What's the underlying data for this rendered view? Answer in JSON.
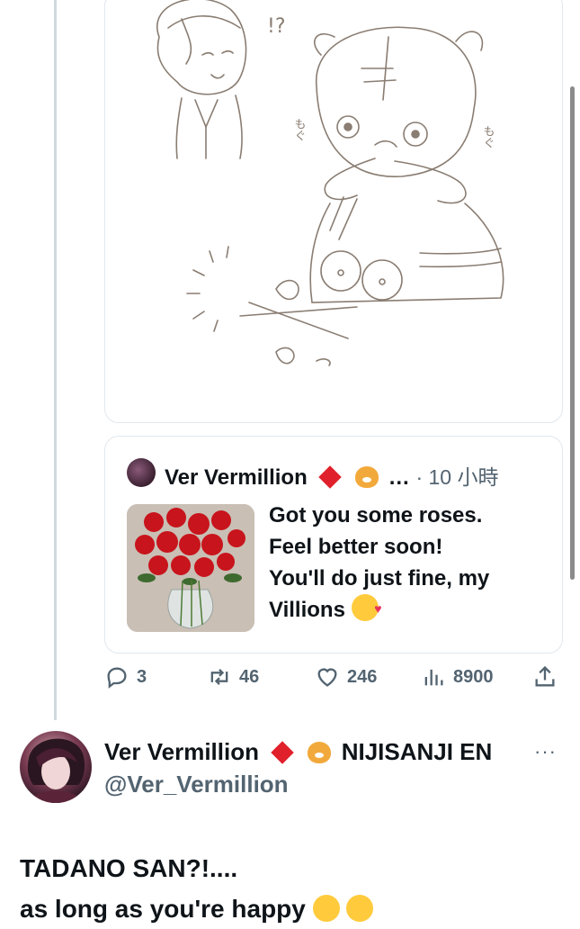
{
  "image_card": {
    "exclamation": "!?",
    "mogu_left": "もぐ",
    "mogu_right": "もぐ"
  },
  "quote": {
    "author_name": "Ver Vermillion",
    "ellipsis": "…",
    "time": "· 10 小時",
    "lines": [
      "Got you some roses.",
      "Feel better soon!",
      "You'll do just fine, my",
      "Villions"
    ]
  },
  "actions": {
    "replies": "3",
    "reposts": "46",
    "likes": "246",
    "views": "8900"
  },
  "tweet": {
    "display_name": "Ver Vermillion",
    "name_suffix": "NIJISANJI EN",
    "handle": "@Ver_Vermillion",
    "more": "···",
    "text_line1": "TADANO SAN?!....",
    "text_line2": "as long as you're happy"
  },
  "colors": {
    "accent_red": "#e0202a",
    "muted": "#536471",
    "border": "#e1e8ed"
  }
}
